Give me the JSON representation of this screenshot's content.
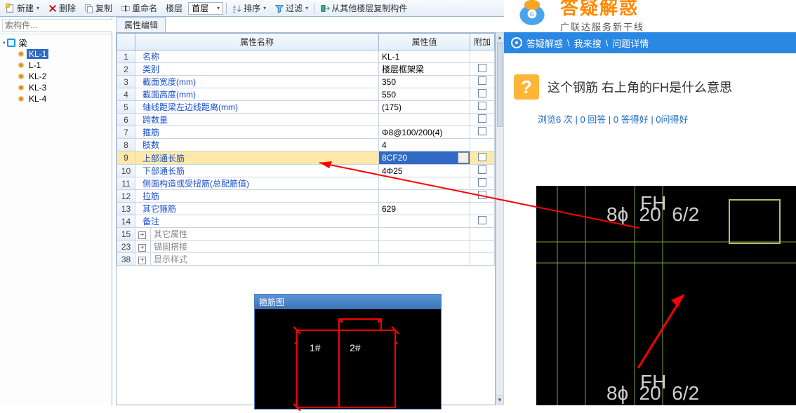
{
  "toolbar": {
    "new": "新建",
    "new_arrow": "▾",
    "del": "删除",
    "copy": "复制",
    "rename": "重命名",
    "floor": "楼层",
    "floor_combo": "首层",
    "sort": "排序",
    "sort_arrow": "▾",
    "filter": "过滤",
    "filter_arrow": "▾",
    "copy_from": "从其他楼层复制构件"
  },
  "search_placeholder": "索构件...",
  "tree": {
    "root": "梁",
    "items": [
      "KL-1",
      "L-1",
      "KL-2",
      "KL-3",
      "KL-4"
    ],
    "selected": 0
  },
  "tab_label": "属性编辑",
  "grid": {
    "head_name": "属性名称",
    "head_value": "属性值",
    "head_extra": "附加",
    "rows": [
      {
        "n": "1",
        "name": "名称",
        "val": "KL-1",
        "chk": false
      },
      {
        "n": "2",
        "name": "类别",
        "val": "楼层框架梁",
        "chk": true
      },
      {
        "n": "3",
        "name": "截面宽度(mm)",
        "val": "350",
        "chk": true
      },
      {
        "n": "4",
        "name": "截面高度(mm)",
        "val": "550",
        "chk": true
      },
      {
        "n": "5",
        "name": "轴线距梁左边线距离(mm)",
        "val": "(175)",
        "chk": true
      },
      {
        "n": "6",
        "name": "跨数量",
        "val": "",
        "chk": true
      },
      {
        "n": "7",
        "name": "箍筋",
        "val": "Φ8@100/200(4)",
        "chk": true
      },
      {
        "n": "8",
        "name": "肢数",
        "val": "4",
        "chk": false
      },
      {
        "n": "9",
        "name": "上部通长筋",
        "val": "8CF20",
        "chk": true,
        "sel": true
      },
      {
        "n": "10",
        "name": "下部通长筋",
        "val": "4Φ25",
        "chk": true
      },
      {
        "n": "11",
        "name": "侧面构造或受扭筋(总配筋值)",
        "val": "",
        "chk": true
      },
      {
        "n": "12",
        "name": "拉筋",
        "val": "",
        "chk": true
      },
      {
        "n": "13",
        "name": "其它箍筋",
        "val": "629",
        "chk": false
      },
      {
        "n": "14",
        "name": "备注",
        "val": "",
        "chk": true
      },
      {
        "n": "15",
        "name": "其它属性",
        "gray": true,
        "exp": "+"
      },
      {
        "n": "23",
        "name": "锚固搭接",
        "gray": true,
        "exp": "+"
      },
      {
        "n": "38",
        "name": "显示样式",
        "gray": true,
        "exp": "+"
      }
    ]
  },
  "stirrup_title": "箍筋图",
  "stirrup_labels": [
    "1#",
    "2#"
  ],
  "web": {
    "brand_title": "答疑解惑",
    "brand_sub": "广联达服务新干线",
    "crumb1": "答疑解惑",
    "crumb2": "我来搜",
    "crumb3": "问题详情",
    "question": "这个钢筋 右上角的FH是什么意思",
    "stats": "浏览6 次 | 0 回答 | 0 答得好 | 0问得好",
    "cad_top": "8ɸ  20  6/2",
    "cad_fh": "FH",
    "cad_bot": "8ɸ  20  6/2"
  }
}
